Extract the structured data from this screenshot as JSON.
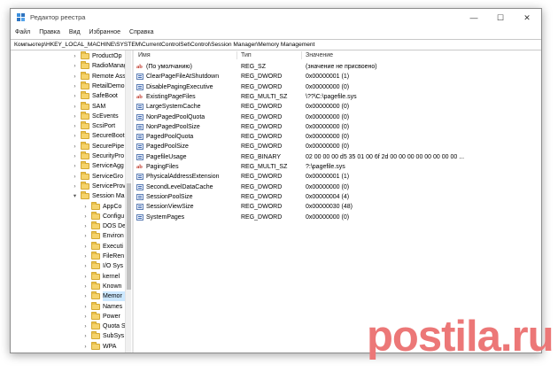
{
  "window": {
    "title": "Редактор реестра",
    "controls": {
      "minimize": "—",
      "maximize": "☐",
      "close": "✕"
    }
  },
  "menu": [
    "Файл",
    "Правка",
    "Вид",
    "Избранное",
    "Справка"
  ],
  "address": "Компьютер\\HKEY_LOCAL_MACHINE\\SYSTEM\\CurrentControlSet\\Control\\Session Manager\\Memory Management",
  "tree": [
    {
      "label": "ProductOp"
    },
    {
      "label": "RadioManag"
    },
    {
      "label": "Remote Ass"
    },
    {
      "label": "RetailDemo"
    },
    {
      "label": "SafeBoot"
    },
    {
      "label": "SAM"
    },
    {
      "label": "ScEvents"
    },
    {
      "label": "ScsiPort"
    },
    {
      "label": "SecureBoot"
    },
    {
      "label": "SecurePipe"
    },
    {
      "label": "SecurityPro"
    },
    {
      "label": "ServiceAgg"
    },
    {
      "label": "ServiceGro"
    },
    {
      "label": "ServiceProv"
    },
    {
      "label": "Session Ma"
    },
    {
      "label": "AppCo"
    },
    {
      "label": "Configu"
    },
    {
      "label": "DOS De"
    },
    {
      "label": "Environ"
    },
    {
      "label": "Executi"
    },
    {
      "label": "FileRen"
    },
    {
      "label": "I/O Sys"
    },
    {
      "label": "kernel"
    },
    {
      "label": "Known"
    },
    {
      "label": "Memor"
    },
    {
      "label": "Names"
    },
    {
      "label": "Power"
    },
    {
      "label": "Quota S"
    },
    {
      "label": "SubSys"
    },
    {
      "label": "WPA"
    }
  ],
  "columns": {
    "name": "Имя",
    "type": "Тип",
    "data": "Значение"
  },
  "rows": [
    {
      "icon": "ab-icon",
      "name": "(По умолчанию)",
      "type": "REG_SZ",
      "data": "(значение не присвоено)"
    },
    {
      "icon": "binary-icon",
      "name": "ClearPageFileAtShutdown",
      "type": "REG_DWORD",
      "data": "0x00000001 (1)"
    },
    {
      "icon": "binary-icon",
      "name": "DisablePagingExecutive",
      "type": "REG_DWORD",
      "data": "0x00000000 (0)"
    },
    {
      "icon": "ab-icon",
      "name": "ExistingPageFiles",
      "type": "REG_MULTI_SZ",
      "data": "\\??\\C:\\pagefile.sys"
    },
    {
      "icon": "binary-icon",
      "name": "LargeSystemCache",
      "type": "REG_DWORD",
      "data": "0x00000000 (0)"
    },
    {
      "icon": "binary-icon",
      "name": "NonPagedPoolQuota",
      "type": "REG_DWORD",
      "data": "0x00000000 (0)"
    },
    {
      "icon": "binary-icon",
      "name": "NonPagedPoolSize",
      "type": "REG_DWORD",
      "data": "0x00000000 (0)"
    },
    {
      "icon": "binary-icon",
      "name": "PagedPoolQuota",
      "type": "REG_DWORD",
      "data": "0x00000000 (0)"
    },
    {
      "icon": "binary-icon",
      "name": "PagedPoolSize",
      "type": "REG_DWORD",
      "data": "0x00000000 (0)"
    },
    {
      "icon": "binary-icon",
      "name": "PagefileUsage",
      "type": "REG_BINARY",
      "data": "02 00 00 00 d5 35 01 00 6f 2d 00 00 00 00 00 00 00 00 ..."
    },
    {
      "icon": "ab-icon",
      "name": "PagingFiles",
      "type": "REG_MULTI_SZ",
      "data": "?:\\pagefile.sys"
    },
    {
      "icon": "binary-icon",
      "name": "PhysicalAddressExtension",
      "type": "REG_DWORD",
      "data": "0x00000001 (1)"
    },
    {
      "icon": "binary-icon",
      "name": "SecondLevelDataCache",
      "type": "REG_DWORD",
      "data": "0x00000000 (0)"
    },
    {
      "icon": "binary-icon",
      "name": "SessionPoolSize",
      "type": "REG_DWORD",
      "data": "0x00000004 (4)"
    },
    {
      "icon": "binary-icon",
      "name": "SessionViewSize",
      "type": "REG_DWORD",
      "data": "0x00000030 (48)"
    },
    {
      "icon": "binary-icon",
      "name": "SystemPages",
      "type": "REG_DWORD",
      "data": "0x00000000 (0)"
    }
  ],
  "watermark": "postila.ru"
}
